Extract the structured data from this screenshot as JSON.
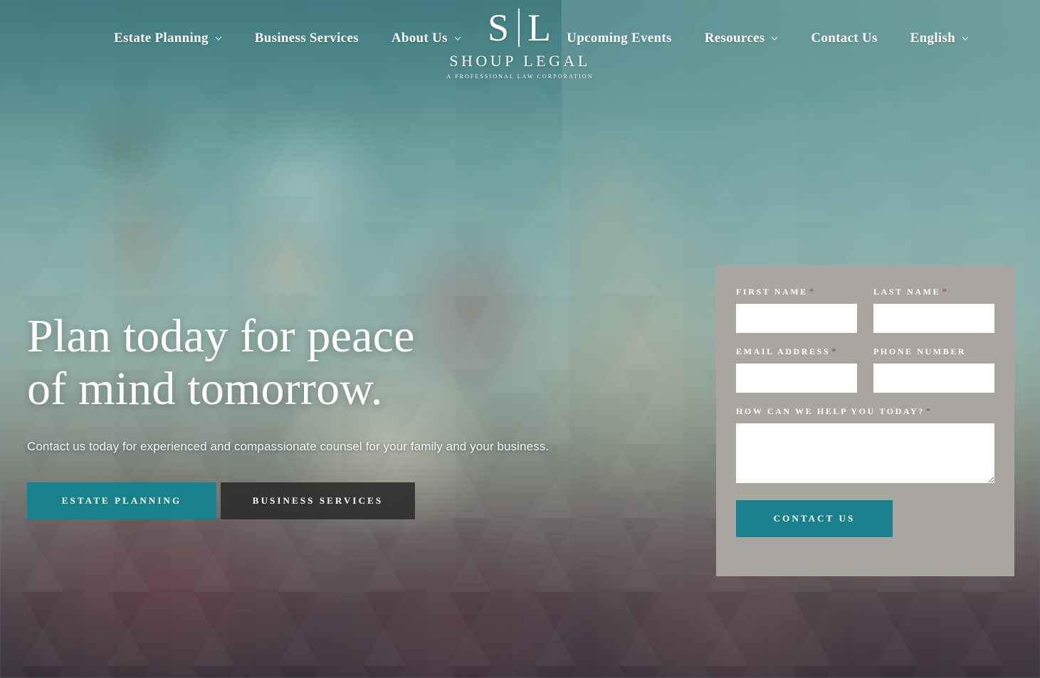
{
  "brand": {
    "monogram_left": "S",
    "monogram_right": "L",
    "name": "SHOUP LEGAL",
    "tagline": "A PROFESSIONAL LAW CORPORATION"
  },
  "colors": {
    "teal_accent": "#19818c",
    "panel_gray": "#a9a5a1",
    "ghost_button": "#2a2a2a",
    "required_asterisk": "#8a6a52",
    "nav_text": "#ffffff"
  },
  "nav": {
    "left": [
      {
        "label": "Estate Planning",
        "has_dropdown": true,
        "icon": "chevron-down-icon"
      },
      {
        "label": "Business Services",
        "has_dropdown": false,
        "icon": ""
      },
      {
        "label": "About Us",
        "has_dropdown": true,
        "icon": "chevron-down-icon"
      }
    ],
    "right": [
      {
        "label": "Upcoming Events",
        "has_dropdown": false,
        "icon": ""
      },
      {
        "label": "Resources",
        "has_dropdown": true,
        "icon": "chevron-down-icon"
      },
      {
        "label": "Contact Us",
        "has_dropdown": false,
        "icon": ""
      },
      {
        "label": "English",
        "has_dropdown": true,
        "icon": "chevron-down-icon"
      }
    ]
  },
  "hero": {
    "headline_line1": "Plan today for peace",
    "headline_line2": "of mind tomorrow.",
    "subheadline": "Contact us today for experienced and compassionate counsel for your family and your business.",
    "cta_primary": "ESTATE PLANNING",
    "cta_secondary": "BUSINESS SERVICES"
  },
  "form": {
    "first_name": {
      "label": "FIRST NAME",
      "required": "*",
      "value": "",
      "placeholder": ""
    },
    "last_name": {
      "label": "LAST NAME",
      "required": "*",
      "value": "",
      "placeholder": ""
    },
    "email": {
      "label": "EMAIL ADDRESS",
      "required": "*",
      "value": "",
      "placeholder": ""
    },
    "phone": {
      "label": "PHONE NUMBER",
      "required": "",
      "value": "",
      "placeholder": ""
    },
    "message": {
      "label": "HOW CAN WE HELP YOU TODAY?",
      "required": "*",
      "value": "",
      "placeholder": ""
    },
    "submit_label": "CONTACT US"
  }
}
